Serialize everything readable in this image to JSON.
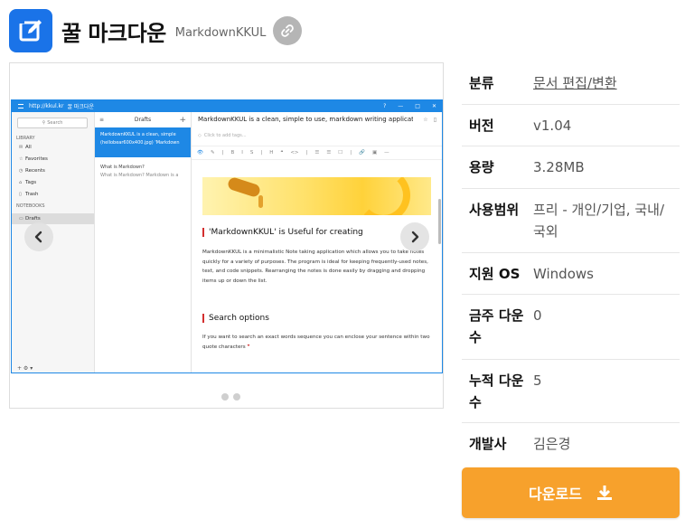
{
  "header": {
    "title": "꿀 마크다운",
    "subtitle": "MarkdownKKUL",
    "icon": "edit-icon",
    "link_icon": "link-icon"
  },
  "screenshot": {
    "app": {
      "titlebar": {
        "url": "http://kkul.kr",
        "name": "꿀 마크다운",
        "controls": [
          "?",
          "—",
          "□",
          "✕"
        ]
      },
      "sidebar": {
        "search_placeholder": "Search",
        "library_label": "LIBRARY",
        "library_items": [
          "All",
          "Favorites",
          "Recents",
          "Tags",
          "Trash"
        ],
        "notebooks_label": "NOTEBOOKS",
        "notebook_items": [
          "Drafts"
        ],
        "footer": "+   ⚙ ▾"
      },
      "list": {
        "title": "Drafts",
        "notes": [
          {
            "title": "MarkdownKKUL is a clean, simple",
            "preview": "(hellobear600x400.jpg) 'Markdown"
          },
          {
            "title": "What is Markdown?",
            "preview": "What is Markdown? Markdown is a"
          }
        ]
      },
      "editor": {
        "note_title": "MarkdownKKUL is a clean, simple to use, markdown writing applicat",
        "tags_placeholder": "Click to add tags...",
        "toolbar": [
          "👁",
          "✎",
          "|",
          "B",
          "I",
          "S",
          "|",
          "H",
          "❝",
          "<>",
          "|",
          "☰",
          "☰",
          "☐",
          "|",
          "🔗",
          "▣",
          "—"
        ],
        "heading1": "'MarkdownKKUL' is Useful for creating",
        "para1": "MarkdownKKUL is a minimalistic Note taking application which allows you to take notes quickly for a variety of purposes. The program is ideal for keeping frequently-used notes, text, and code snippets. Rearranging the notes is done easily by dragging and dropping items up or down the list.",
        "heading2": "Search options",
        "para2": "If you want to search an exact words sequence you can enclose your sentence within two quote characters"
      }
    },
    "prev_icon": "chevron-left-icon",
    "next_icon": "chevron-right-icon",
    "slide_count": 2,
    "active_slide": 1
  },
  "info": {
    "category": {
      "label": "분류",
      "value": "문서 편집/변환"
    },
    "version": {
      "label": "버전",
      "value": "v1.04"
    },
    "size": {
      "label": "용량",
      "value": "3.28MB"
    },
    "license": {
      "label": "사용범위",
      "value": "프리 - 개인/기업, 국내/국외"
    },
    "os": {
      "label": "지원 OS",
      "value": "Windows"
    },
    "weekly": {
      "label": "금주 다운수",
      "value": "0"
    },
    "total": {
      "label": "누적 다운수",
      "value": "5"
    },
    "developer": {
      "label": "개발사",
      "value": "김은경"
    }
  },
  "download": {
    "label": "다운로드",
    "icon": "download-icon"
  },
  "colors": {
    "brand": "#1a73e8",
    "download": "#f7a12c",
    "inner_accent": "#1e88e5"
  }
}
